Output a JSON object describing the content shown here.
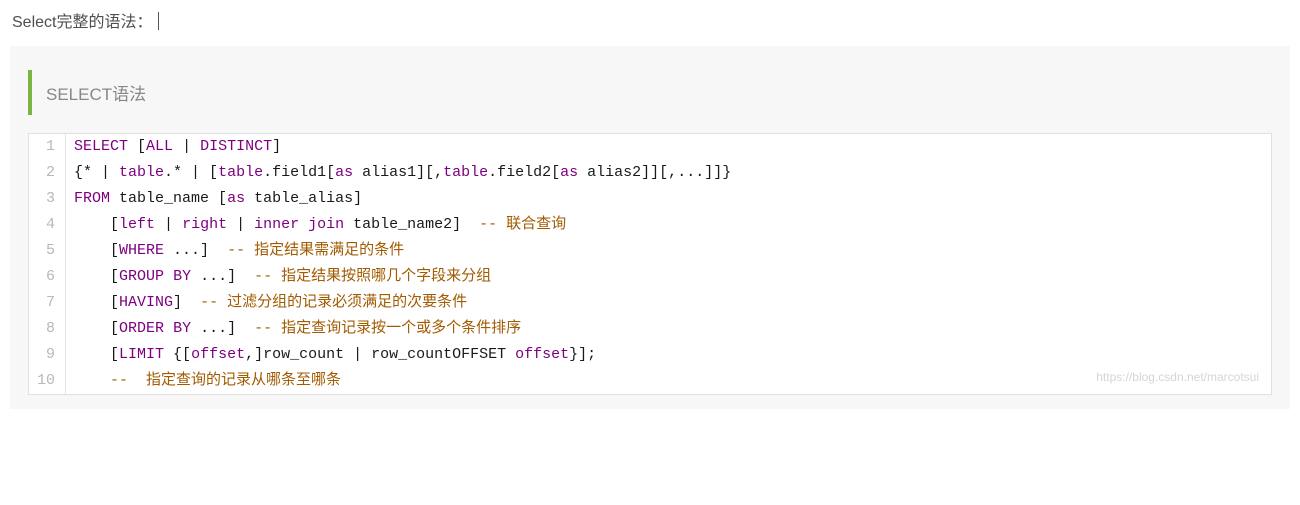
{
  "heading": "Select完整的语法：",
  "quote_title": "SELECT语法",
  "watermark": "https://blog.csdn.net/marcotsui",
  "code_lines": [
    {
      "n": 1,
      "tokens": [
        {
          "c": "kw",
          "t": "SELECT"
        },
        {
          "c": "plain",
          "t": " ["
        },
        {
          "c": "kw",
          "t": "ALL"
        },
        {
          "c": "plain",
          "t": " | "
        },
        {
          "c": "kw",
          "t": "DISTINCT"
        },
        {
          "c": "plain",
          "t": "]"
        }
      ]
    },
    {
      "n": 2,
      "tokens": [
        {
          "c": "plain",
          "t": "{* | "
        },
        {
          "c": "kw",
          "t": "table"
        },
        {
          "c": "plain",
          "t": ".* | ["
        },
        {
          "c": "kw",
          "t": "table"
        },
        {
          "c": "plain",
          "t": ".field1["
        },
        {
          "c": "kw",
          "t": "as"
        },
        {
          "c": "plain",
          "t": " alias1][,"
        },
        {
          "c": "kw",
          "t": "table"
        },
        {
          "c": "plain",
          "t": ".field2["
        },
        {
          "c": "kw",
          "t": "as"
        },
        {
          "c": "plain",
          "t": " alias2]][,...]]}"
        }
      ]
    },
    {
      "n": 3,
      "tokens": [
        {
          "c": "kw",
          "t": "FROM"
        },
        {
          "c": "plain",
          "t": " table_name ["
        },
        {
          "c": "kw",
          "t": "as"
        },
        {
          "c": "plain",
          "t": " table_alias]"
        }
      ]
    },
    {
      "n": 4,
      "tokens": [
        {
          "c": "plain",
          "t": "    ["
        },
        {
          "c": "kw",
          "t": "left"
        },
        {
          "c": "plain",
          "t": " | "
        },
        {
          "c": "kw",
          "t": "right"
        },
        {
          "c": "plain",
          "t": " | "
        },
        {
          "c": "kw",
          "t": "inner"
        },
        {
          "c": "plain",
          "t": " "
        },
        {
          "c": "kw",
          "t": "join"
        },
        {
          "c": "plain",
          "t": " table_name2]  "
        },
        {
          "c": "cmt",
          "t": "-- 联合查询"
        }
      ]
    },
    {
      "n": 5,
      "tokens": [
        {
          "c": "plain",
          "t": "    ["
        },
        {
          "c": "kw",
          "t": "WHERE"
        },
        {
          "c": "plain",
          "t": " ...]  "
        },
        {
          "c": "cmt",
          "t": "-- 指定结果需满足的条件"
        }
      ]
    },
    {
      "n": 6,
      "tokens": [
        {
          "c": "plain",
          "t": "    ["
        },
        {
          "c": "kw",
          "t": "GROUP"
        },
        {
          "c": "plain",
          "t": " "
        },
        {
          "c": "kw",
          "t": "BY"
        },
        {
          "c": "plain",
          "t": " ...]  "
        },
        {
          "c": "cmt",
          "t": "-- 指定结果按照哪几个字段来分组"
        }
      ]
    },
    {
      "n": 7,
      "tokens": [
        {
          "c": "plain",
          "t": "    ["
        },
        {
          "c": "kw",
          "t": "HAVING"
        },
        {
          "c": "plain",
          "t": "]  "
        },
        {
          "c": "cmt",
          "t": "-- 过滤分组的记录必须满足的次要条件"
        }
      ]
    },
    {
      "n": 8,
      "tokens": [
        {
          "c": "plain",
          "t": "    ["
        },
        {
          "c": "kw",
          "t": "ORDER"
        },
        {
          "c": "plain",
          "t": " "
        },
        {
          "c": "kw",
          "t": "BY"
        },
        {
          "c": "plain",
          "t": " ...]  "
        },
        {
          "c": "cmt",
          "t": "-- 指定查询记录按一个或多个条件排序"
        }
      ]
    },
    {
      "n": 9,
      "tokens": [
        {
          "c": "plain",
          "t": "    ["
        },
        {
          "c": "kw",
          "t": "LIMIT"
        },
        {
          "c": "plain",
          "t": " {["
        },
        {
          "c": "kw",
          "t": "offset"
        },
        {
          "c": "plain",
          "t": ",]row_count | row_countOFFSET "
        },
        {
          "c": "kw",
          "t": "offset"
        },
        {
          "c": "plain",
          "t": "}];"
        }
      ]
    },
    {
      "n": 10,
      "tokens": [
        {
          "c": "plain",
          "t": "    "
        },
        {
          "c": "cmt",
          "t": "--  指定查询的记录从哪条至哪条"
        }
      ]
    }
  ]
}
